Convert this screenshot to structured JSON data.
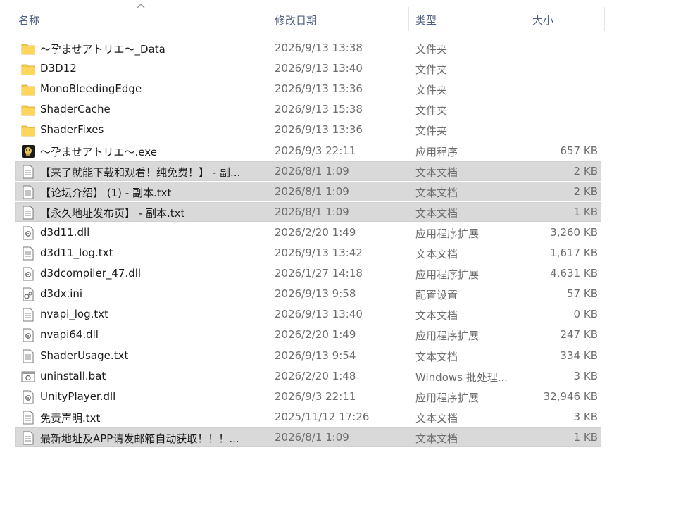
{
  "columns": {
    "name": "名称",
    "date": "修改日期",
    "type": "类型",
    "size": "大小"
  },
  "files": [
    {
      "icon": "folder-icon",
      "name": "～孕ませアトリエ～_Data",
      "date": "2026/9/13 13:38",
      "type": "文件夹",
      "size": "",
      "selected": false
    },
    {
      "icon": "folder-icon",
      "name": "D3D12",
      "date": "2026/9/13 13:40",
      "type": "文件夹",
      "size": "",
      "selected": false
    },
    {
      "icon": "folder-icon",
      "name": "MonoBleedingEdge",
      "date": "2026/9/13 13:36",
      "type": "文件夹",
      "size": "",
      "selected": false
    },
    {
      "icon": "folder-icon",
      "name": "ShaderCache",
      "date": "2026/9/13 15:38",
      "type": "文件夹",
      "size": "",
      "selected": false
    },
    {
      "icon": "folder-icon",
      "name": "ShaderFixes",
      "date": "2026/9/13 13:36",
      "type": "文件夹",
      "size": "",
      "selected": false
    },
    {
      "icon": "app-icon",
      "name": "～孕ませアトリエ～.exe",
      "date": "2026/9/3 22:11",
      "type": "应用程序",
      "size": "657 KB",
      "selected": false
    },
    {
      "icon": "text-file-icon",
      "name": "【来了就能下载和观看！纯免费！】 - 副...",
      "date": "2026/8/1 1:09",
      "type": "文本文档",
      "size": "2 KB",
      "selected": true
    },
    {
      "icon": "text-file-icon",
      "name": "【论坛介绍】 (1) - 副本.txt",
      "date": "2026/8/1 1:09",
      "type": "文本文档",
      "size": "2 KB",
      "selected": true
    },
    {
      "icon": "text-file-icon",
      "name": "【永久地址发布页】 - 副本.txt",
      "date": "2026/8/1 1:09",
      "type": "文本文档",
      "size": "1 KB",
      "selected": true
    },
    {
      "icon": "dll-file-icon",
      "name": "d3d11.dll",
      "date": "2026/2/20 1:49",
      "type": "应用程序扩展",
      "size": "3,260 KB",
      "selected": false
    },
    {
      "icon": "text-file-icon",
      "name": "d3d11_log.txt",
      "date": "2026/9/13 13:42",
      "type": "文本文档",
      "size": "1,617 KB",
      "selected": false
    },
    {
      "icon": "dll-file-icon",
      "name": "d3dcompiler_47.dll",
      "date": "2026/1/27 14:18",
      "type": "应用程序扩展",
      "size": "4,631 KB",
      "selected": false
    },
    {
      "icon": "ini-file-icon",
      "name": "d3dx.ini",
      "date": "2026/9/13 9:58",
      "type": "配置设置",
      "size": "57 KB",
      "selected": false
    },
    {
      "icon": "text-file-icon",
      "name": "nvapi_log.txt",
      "date": "2026/9/13 13:40",
      "type": "文本文档",
      "size": "0 KB",
      "selected": false
    },
    {
      "icon": "dll-file-icon",
      "name": "nvapi64.dll",
      "date": "2026/2/20 1:49",
      "type": "应用程序扩展",
      "size": "247 KB",
      "selected": false
    },
    {
      "icon": "text-file-icon",
      "name": "ShaderUsage.txt",
      "date": "2026/9/13 9:54",
      "type": "文本文档",
      "size": "334 KB",
      "selected": false
    },
    {
      "icon": "bat-file-icon",
      "name": "uninstall.bat",
      "date": "2026/2/20 1:48",
      "type": "Windows 批处理...",
      "size": "3 KB",
      "selected": false
    },
    {
      "icon": "dll-file-icon",
      "name": "UnityPlayer.dll",
      "date": "2026/9/3 22:11",
      "type": "应用程序扩展",
      "size": "32,946 KB",
      "selected": false
    },
    {
      "icon": "text-file-icon",
      "name": "免责声明.txt",
      "date": "2025/11/12 17:26",
      "type": "文本文档",
      "size": "3 KB",
      "selected": false
    },
    {
      "icon": "text-file-icon",
      "name": "最新地址及APP请发邮箱自动获取！！！...",
      "date": "2026/8/1 1:09",
      "type": "文本文档",
      "size": "1 KB",
      "selected": true
    }
  ],
  "colors": {
    "folder": "#f2c94c",
    "selection": "#d9d9d9",
    "header_text": "#4d6082"
  }
}
